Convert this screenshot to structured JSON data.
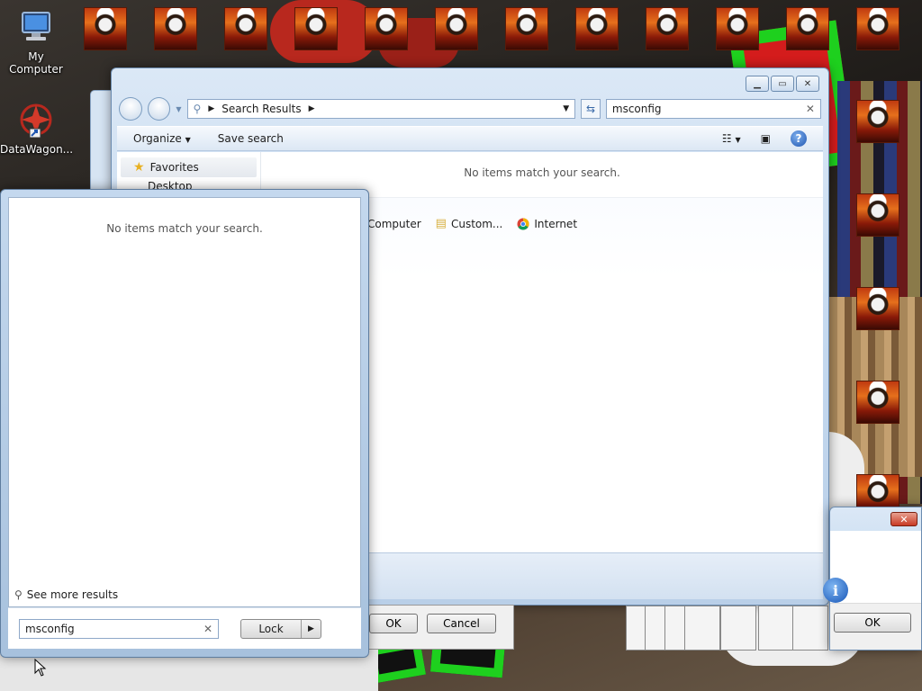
{
  "desktop": {
    "icons": [
      {
        "label": "My Computer"
      },
      {
        "label": "DataWagon..."
      }
    ]
  },
  "explorer": {
    "address_path": "Search Results",
    "search_value": "msconfig",
    "toolbar": {
      "organize": "Organize",
      "save_search": "Save search"
    },
    "nav": {
      "favorites": "Favorites",
      "desktop": "Desktop"
    },
    "no_items": "No items match your search.",
    "search_again": [
      {
        "label": "Computer",
        "icon": "computer-icon"
      },
      {
        "label": "Custom...",
        "icon": "folder-icon"
      },
      {
        "label": "Internet",
        "icon": "chrome-icon"
      }
    ]
  },
  "dialog_strip": {
    "ok": "OK",
    "cancel": "Cancel"
  },
  "message_box": {
    "ok": "OK",
    "close": "✕"
  },
  "start_search": {
    "no_items": "No items match your search.",
    "see_more": "See more results",
    "input_value": "msconfig",
    "lock_label": "Lock"
  },
  "colors": {
    "accent": "#1e55b0",
    "glass": "#c7dcf2",
    "green": "#1ed01e"
  }
}
